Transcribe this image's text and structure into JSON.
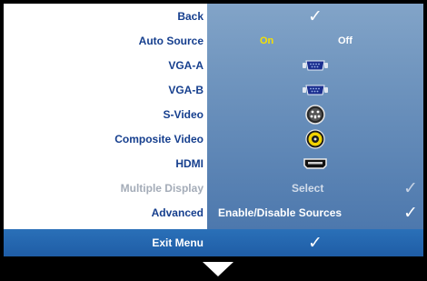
{
  "menu": {
    "rows": [
      {
        "label": "Back",
        "value": "✓"
      },
      {
        "label": "Auto Source",
        "on": "On",
        "off": "Off"
      },
      {
        "label": "VGA-A",
        "icon": "vga-port-icon"
      },
      {
        "label": "VGA-B",
        "icon": "vga-port-icon"
      },
      {
        "label": "S-Video",
        "icon": "s-video-port-icon"
      },
      {
        "label": "Composite Video",
        "icon": "composite-rca-port-icon"
      },
      {
        "label": "HDMI",
        "icon": "hdmi-port-icon"
      },
      {
        "label": "Multiple Display",
        "value": "Select",
        "check": "✓",
        "disabled": true
      },
      {
        "label": "Advanced",
        "value": "Enable/Disable Sources",
        "check": "✓"
      }
    ],
    "exit": {
      "label": "Exit Menu",
      "check": "✓"
    },
    "more_icon": "down-arrow-icon"
  },
  "colors": {
    "label_text": "#163f8e",
    "label_disabled": "#a4acb8",
    "value_panel": "#6f93bd",
    "on_highlight": "#f5e100",
    "exit_bar": "#1f5da6",
    "background": "#000000"
  }
}
